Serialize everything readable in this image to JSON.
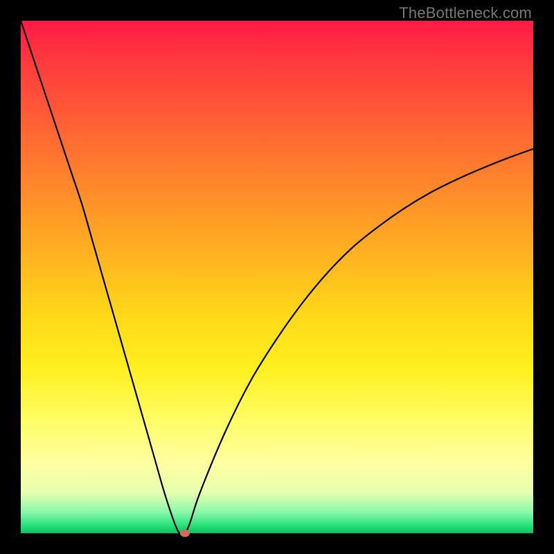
{
  "attribution": "TheBottleneck.com",
  "colors": {
    "gradient_top": "#ff1a47",
    "gradient_bottom": "#0fc060",
    "curve": "#000000",
    "marker": "#d46a5c",
    "frame": "#000000"
  },
  "chart_data": {
    "type": "line",
    "title": "",
    "xlabel": "",
    "ylabel": "",
    "xlim": [
      0,
      100
    ],
    "ylim": [
      0,
      100
    ],
    "grid": false,
    "legend": false,
    "series": [
      {
        "name": "bottleneck-curve",
        "x": [
          0,
          2,
          4,
          6,
          8,
          10,
          12,
          14,
          16,
          18,
          20,
          22,
          24,
          26,
          28,
          30,
          31,
          32,
          33,
          35,
          40,
          45,
          50,
          55,
          60,
          65,
          70,
          75,
          80,
          85,
          90,
          95,
          100
        ],
        "values": [
          100,
          94,
          88,
          82,
          76,
          70,
          64,
          57,
          50,
          43,
          36,
          29,
          22,
          15,
          8,
          2,
          0,
          0,
          2,
          8,
          20,
          30,
          38,
          45,
          51,
          56,
          60,
          63.5,
          66.5,
          69,
          71.2,
          73.2,
          75
        ]
      }
    ],
    "marker": {
      "x": 32,
      "y": 0
    },
    "annotations": []
  }
}
